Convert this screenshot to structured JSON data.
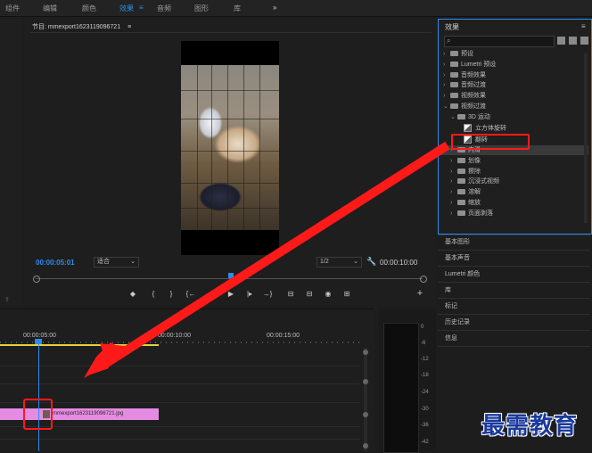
{
  "workspace_tabs": [
    {
      "label": "组件",
      "active": false
    },
    {
      "label": "编辑",
      "active": false
    },
    {
      "label": "颜色",
      "active": false
    },
    {
      "label": "效果",
      "active": true
    },
    {
      "label": "音频",
      "active": false
    },
    {
      "label": "图形",
      "active": false
    },
    {
      "label": "库",
      "active": false
    },
    {
      "label": "»",
      "active": false
    }
  ],
  "active_tab_menu": "≡",
  "program": {
    "title": "节目: mmexport1623119096721",
    "menu": "≡",
    "timecode_current": "00:00:05:01",
    "fit_label": "适合",
    "resolution_label": "1/2",
    "timecode_duration": "00:00:10:00"
  },
  "transport": [
    "◆",
    "{",
    "}",
    "{←",
    "◂|",
    "▶",
    "|▸",
    "→}",
    "⊟",
    "⊟",
    "◉",
    "⊞"
  ],
  "add_button": "+",
  "effects": {
    "title": "效果",
    "menu": "≡",
    "tree": [
      {
        "label": "预设",
        "level": 0,
        "kind": "folder",
        "expanded": false
      },
      {
        "label": "Lumetri 预设",
        "level": 0,
        "kind": "folder",
        "expanded": false
      },
      {
        "label": "音频效果",
        "level": 0,
        "kind": "folder",
        "expanded": false
      },
      {
        "label": "音频过渡",
        "level": 0,
        "kind": "folder",
        "expanded": false
      },
      {
        "label": "视频效果",
        "level": 0,
        "kind": "folder",
        "expanded": false
      },
      {
        "label": "视频过渡",
        "level": 0,
        "kind": "folder",
        "expanded": true
      },
      {
        "label": "3D 运动",
        "level": 1,
        "kind": "folder",
        "expanded": true
      },
      {
        "label": "立方体旋转",
        "level": 2,
        "kind": "effect"
      },
      {
        "label": "翻转",
        "level": 2,
        "kind": "effect"
      },
      {
        "label": "内滑",
        "level": 1,
        "kind": "folder",
        "expanded": false
      },
      {
        "label": "划像",
        "level": 1,
        "kind": "folder",
        "expanded": false
      },
      {
        "label": "擦除",
        "level": 1,
        "kind": "folder",
        "expanded": false
      },
      {
        "label": "沉浸式视频",
        "level": 1,
        "kind": "folder",
        "expanded": false
      },
      {
        "label": "溶解",
        "level": 1,
        "kind": "folder",
        "expanded": false
      },
      {
        "label": "缩放",
        "level": 1,
        "kind": "folder",
        "expanded": false
      },
      {
        "label": "页面剥落",
        "level": 1,
        "kind": "folder",
        "expanded": false
      }
    ]
  },
  "side_panels": [
    "基本图形",
    "基本声音",
    "Lumetri 颜色",
    "库",
    "标记",
    "历史记录",
    "信息"
  ],
  "timeline": {
    "ruler_labels": [
      "00:00:05:00",
      "00:00:10:00",
      "00:00:15:00"
    ],
    "clip_name": "mmexport1623119096721.jpg"
  },
  "meter": {
    "db_labels": [
      "0",
      "-6",
      "-12",
      "-18",
      "-24",
      "-30",
      "-36",
      "-42"
    ]
  },
  "watermark": "最需教育",
  "colors": {
    "accent_blue": "#2d8ceb",
    "clip_pink": "#e58be1",
    "annotation_red": "#ff1a1a",
    "workarea_yellow": "#e4d23b"
  }
}
